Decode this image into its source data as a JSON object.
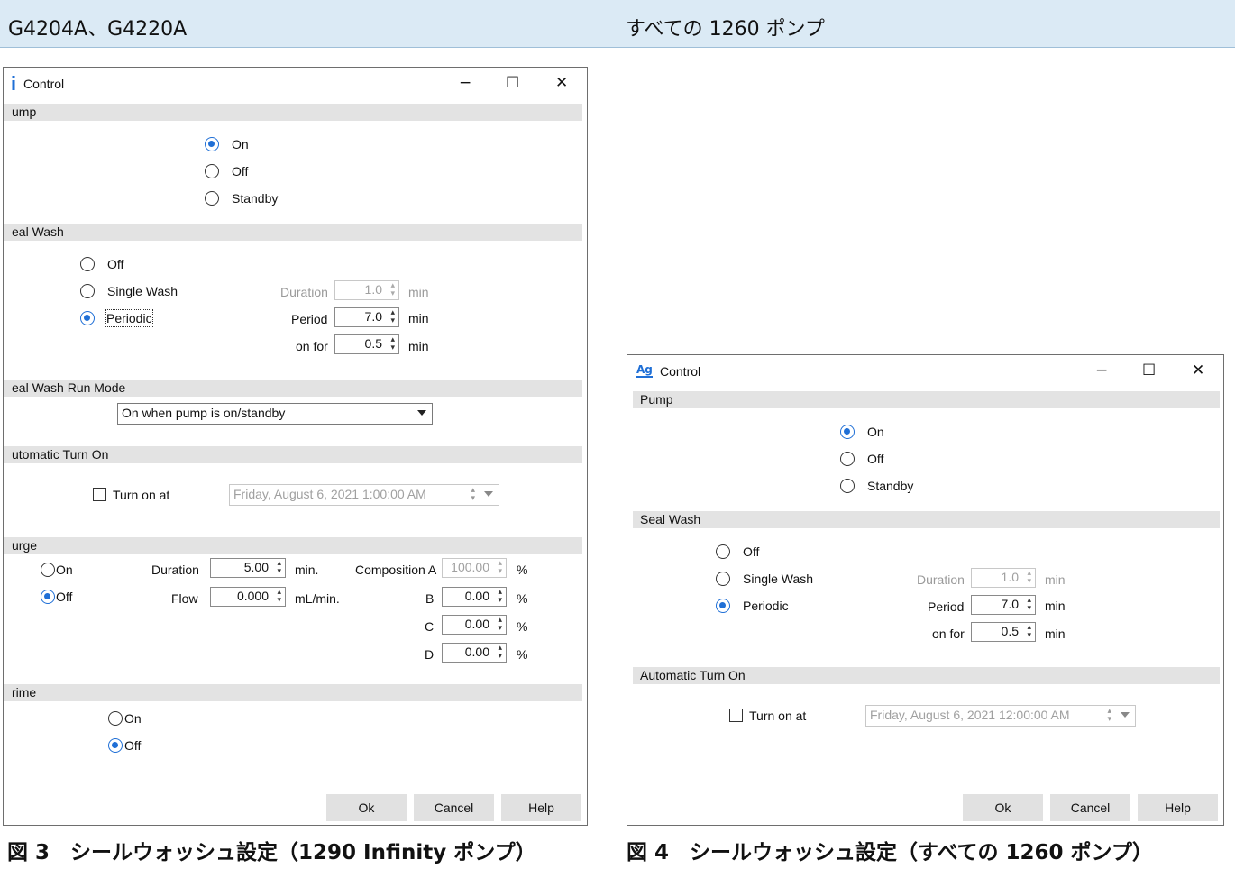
{
  "header": {
    "left_label": "G4204A、G4220A",
    "right_label": "すべての 1260 ポンプ"
  },
  "captions": {
    "left": "図 3　シールウォッシュ設定（1290 Infinity ポンプ）",
    "right": "図 4　シールウォッシュ設定（すべての 1260 ポンプ）"
  },
  "dialog_left": {
    "title": "Control",
    "title_controls": {
      "minimize": "−",
      "maximize": "☐",
      "close": "✕"
    },
    "pump": {
      "section": "ump",
      "options": [
        "On",
        "Off",
        "Standby"
      ],
      "selected": "On"
    },
    "seal_wash": {
      "section": "eal Wash",
      "options": [
        "Off",
        "Single Wash",
        "Periodic"
      ],
      "selected": "Periodic",
      "duration_label": "Duration",
      "duration_value": "1.0",
      "duration_unit": "min",
      "period_label": "Period",
      "period_value": "7.0",
      "period_unit": "min",
      "onfor_label": "on for",
      "onfor_value": "0.5",
      "onfor_unit": "min"
    },
    "run_mode": {
      "section": "eal Wash Run Mode",
      "value": "On when pump is on/standby"
    },
    "auto_turn_on": {
      "section": "utomatic Turn On",
      "checkbox_label": "Turn on at",
      "datetime": "Friday, August 6, 2021   1:00:00 AM"
    },
    "purge": {
      "section": "urge",
      "on_label": "On",
      "off_label": "Off",
      "selected": "Off",
      "duration_label": "Duration",
      "duration_value": "5.00",
      "duration_unit": "min.",
      "flow_label": "Flow",
      "flow_value": "0.000",
      "flow_unit": "mL/min.",
      "comp_a_label": "Composition A",
      "comp_a_value": "100.00",
      "comp_b_label": "B",
      "comp_b_value": "0.00",
      "comp_c_label": "C",
      "comp_c_value": "0.00",
      "comp_d_label": "D",
      "comp_d_value": "0.00",
      "percent": "%"
    },
    "prime": {
      "section": "rime",
      "on_label": "On",
      "off_label": "Off",
      "selected": "Off"
    },
    "buttons": {
      "ok": "Ok",
      "cancel": "Cancel",
      "help": "Help"
    }
  },
  "dialog_right": {
    "title": "Control",
    "title_controls": {
      "minimize": "−",
      "maximize": "☐",
      "close": "✕"
    },
    "pump": {
      "section": "Pump",
      "options": [
        "On",
        "Off",
        "Standby"
      ],
      "selected": "On"
    },
    "seal_wash": {
      "section": "Seal Wash",
      "options": [
        "Off",
        "Single Wash",
        "Periodic"
      ],
      "selected": "Periodic",
      "duration_label": "Duration",
      "duration_value": "1.0",
      "duration_unit": "min",
      "period_label": "Period",
      "period_value": "7.0",
      "period_unit": "min",
      "onfor_label": "on for",
      "onfor_value": "0.5",
      "onfor_unit": "min"
    },
    "auto_turn_on": {
      "section": "Automatic Turn On",
      "checkbox_label": "Turn on at",
      "datetime": "Friday, August 6, 2021   12:00:00 AM"
    },
    "buttons": {
      "ok": "Ok",
      "cancel": "Cancel",
      "help": "Help"
    }
  }
}
